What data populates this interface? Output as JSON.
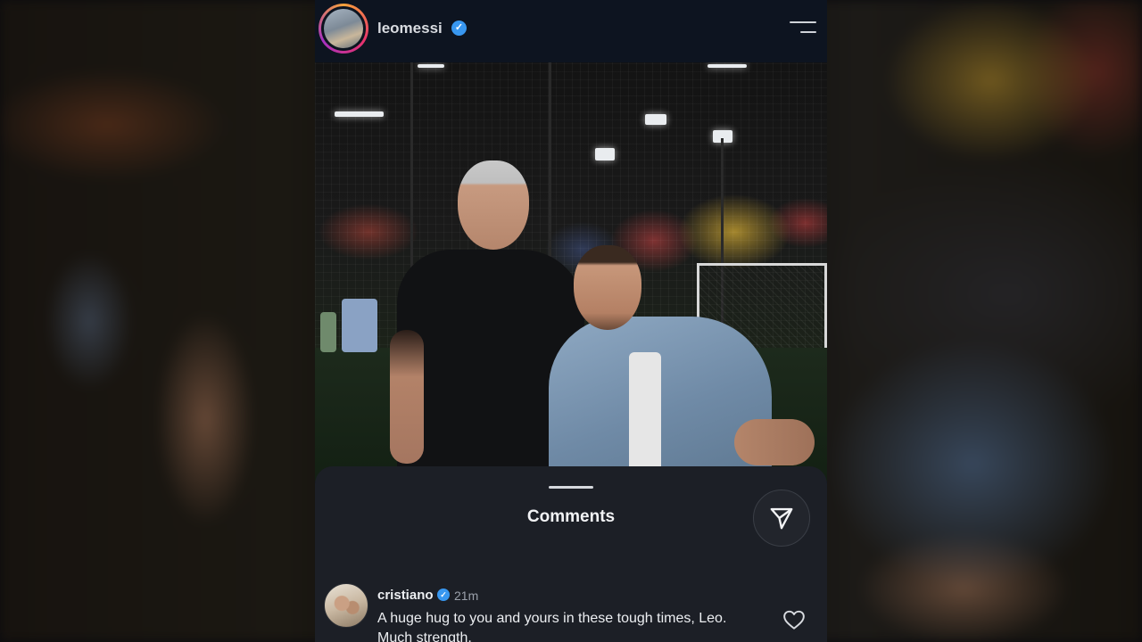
{
  "post": {
    "username": "leomessi",
    "verified_glyph": "✓",
    "avatar_icon": "profile-avatar",
    "menu_icon": "hamburger-menu-icon"
  },
  "comments_panel": {
    "title": "Comments",
    "share_icon": "send-icon"
  },
  "comments": [
    {
      "username": "cristiano",
      "verified_glyph": "✓",
      "time": "21m",
      "text": "A huge hug to you and yours in these tough times, Leo. Much strength.",
      "like_icon": "heart-icon"
    }
  ],
  "colors": {
    "verified_badge": "#3897f0",
    "sheet_background": "#1c1f26",
    "header_background": "#0d1420"
  }
}
